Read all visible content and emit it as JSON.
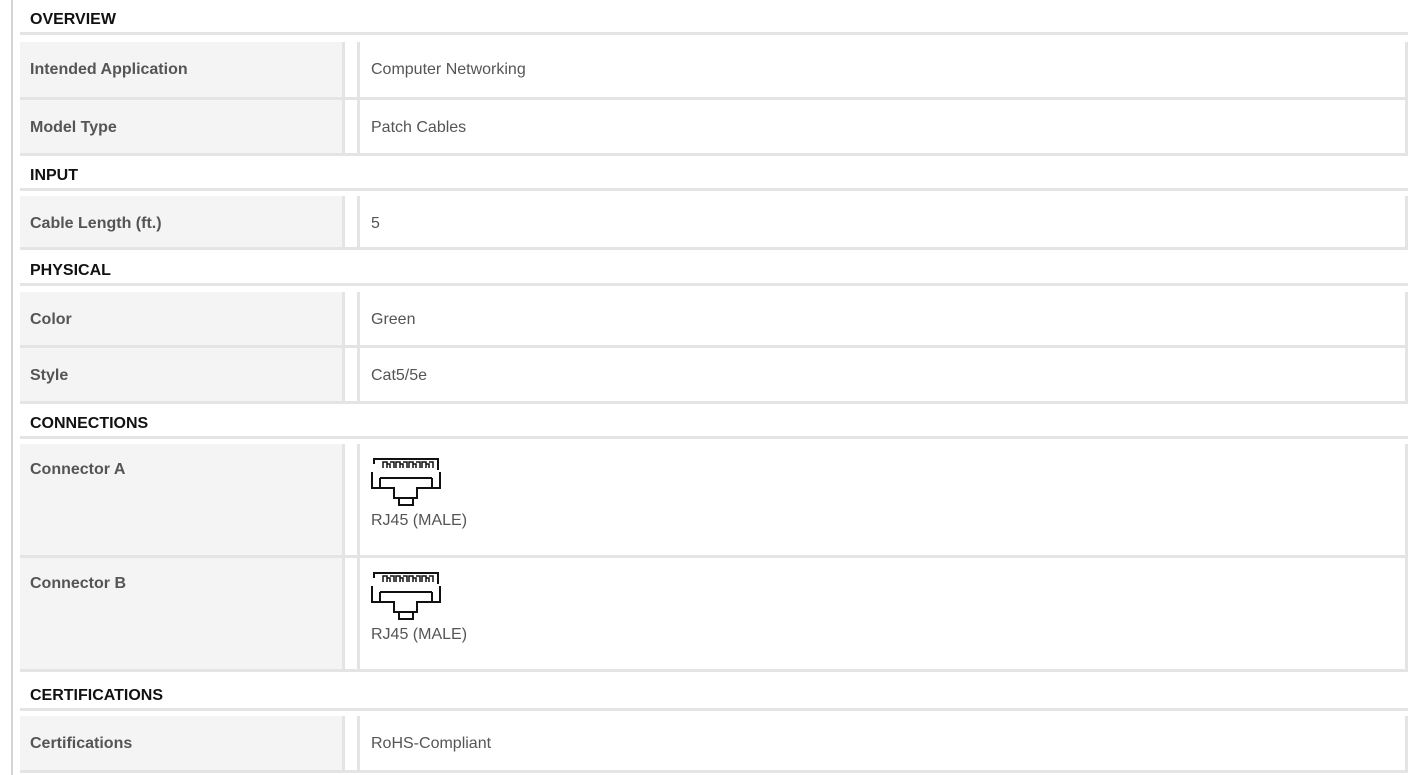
{
  "sections": [
    {
      "title": "OVERVIEW",
      "rows": [
        {
          "label": "Intended Application",
          "value": "Computer Networking"
        },
        {
          "label": "Model Type",
          "value": "Patch Cables"
        }
      ]
    },
    {
      "title": "INPUT",
      "rows": [
        {
          "label": "Cable Length (ft.)",
          "value": "5"
        }
      ]
    },
    {
      "title": "PHYSICAL",
      "rows": [
        {
          "label": "Color",
          "value": "Green"
        },
        {
          "label": "Style",
          "value": "Cat5/5e"
        }
      ]
    },
    {
      "title": "CONNECTIONS",
      "rows": [
        {
          "label": "Connector A",
          "value": "RJ45 (MALE)",
          "icon": "rj45-connector-icon"
        },
        {
          "label": "Connector B",
          "value": "RJ45 (MALE)",
          "icon": "rj45-connector-icon"
        }
      ]
    },
    {
      "title": "CERTIFICATIONS",
      "rows": [
        {
          "label": "Certifications",
          "value": "RoHS-Compliant"
        }
      ]
    }
  ]
}
